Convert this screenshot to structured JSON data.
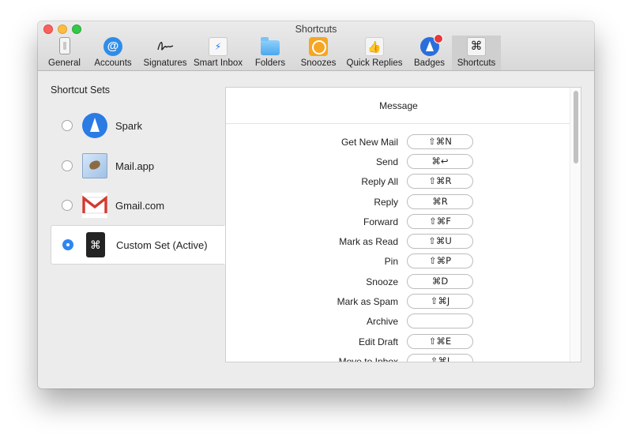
{
  "window": {
    "title": "Shortcuts"
  },
  "toolbar": {
    "tabs": [
      {
        "label": "General",
        "icon": "general-icon"
      },
      {
        "label": "Accounts",
        "icon": "accounts-icon"
      },
      {
        "label": "Signatures",
        "icon": "signature-icon"
      },
      {
        "label": "Smart Inbox",
        "icon": "smart-inbox-icon"
      },
      {
        "label": "Folders",
        "icon": "folder-icon"
      },
      {
        "label": "Snoozes",
        "icon": "snooze-icon"
      },
      {
        "label": "Quick Replies",
        "icon": "quick-replies-icon"
      },
      {
        "label": "Badges",
        "icon": "badges-icon"
      },
      {
        "label": "Shortcuts",
        "icon": "shortcuts-icon",
        "active": true
      }
    ]
  },
  "sidebar": {
    "title": "Shortcut Sets",
    "sets": [
      {
        "label": "Spark",
        "icon": "spark-icon",
        "selected": false
      },
      {
        "label": "Mail.app",
        "icon": "mail-app-icon",
        "selected": false
      },
      {
        "label": "Gmail.com",
        "icon": "gmail-icon",
        "selected": false
      },
      {
        "label": "Custom Set (Active)",
        "icon": "custom-set-icon",
        "selected": true
      }
    ]
  },
  "panel": {
    "header": "Message",
    "shortcuts": [
      {
        "label": "Get New Mail",
        "key": "⇧⌘N"
      },
      {
        "label": "Send",
        "key": "⌘↩"
      },
      {
        "label": "Reply All",
        "key": "⇧⌘R"
      },
      {
        "label": "Reply",
        "key": "⌘R"
      },
      {
        "label": "Forward",
        "key": "⇧⌘F"
      },
      {
        "label": "Mark as Read",
        "key": "⇧⌘U"
      },
      {
        "label": "Pin",
        "key": "⇧⌘P"
      },
      {
        "label": "Snooze",
        "key": "⌘D"
      },
      {
        "label": "Mark as Spam",
        "key": "⇧⌘J"
      },
      {
        "label": "Archive",
        "key": ""
      },
      {
        "label": "Edit Draft",
        "key": "⇧⌘E"
      },
      {
        "label": "Move to Inbox",
        "key": "⇧⌘I"
      }
    ]
  },
  "icons": {
    "accounts": "@",
    "smart_inbox": "⚡",
    "quick_replies": "👍",
    "shortcuts": "⌘",
    "custom_set": "⌘"
  },
  "colors": {
    "accent": "#2f86f0",
    "badge_red": "#e8383d"
  }
}
